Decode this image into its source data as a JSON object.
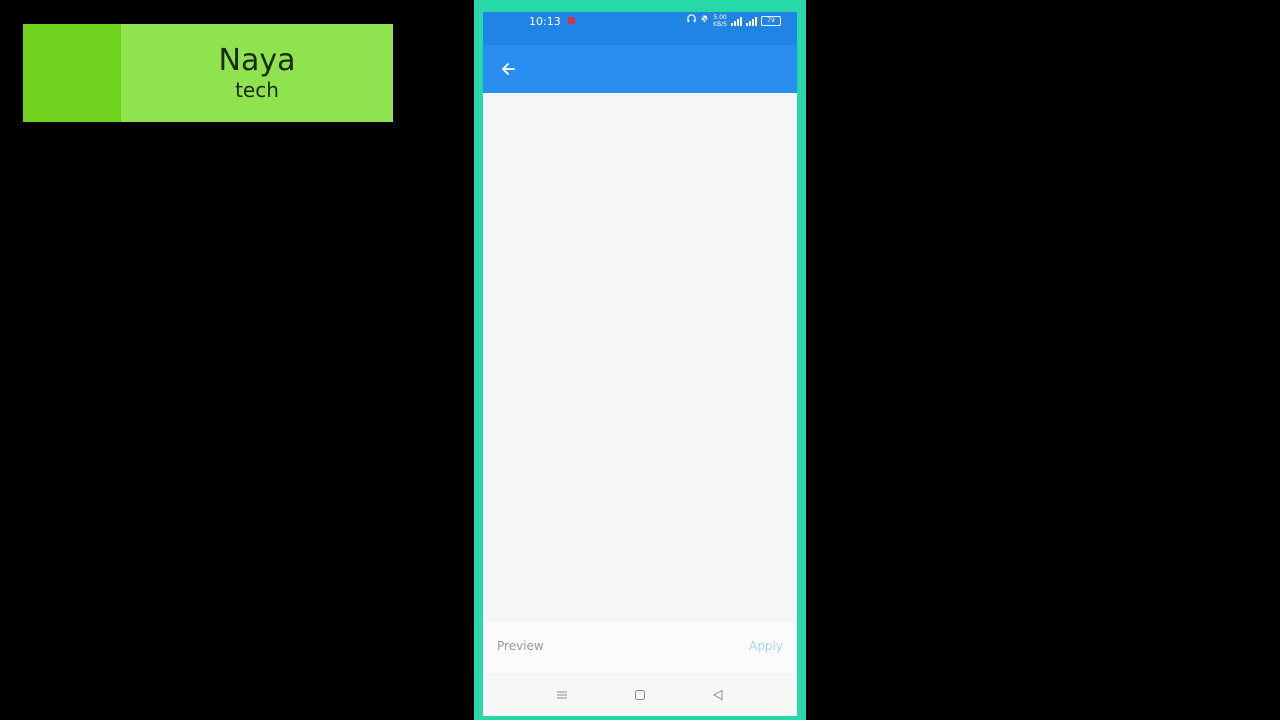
{
  "brand": {
    "name": "Naya",
    "sub": "tech"
  },
  "status_bar": {
    "time": "10:13",
    "net_speed_value": "5.00",
    "net_speed_unit": "KB/S",
    "battery": "79"
  },
  "app_bar": {
    "back_icon": "arrow-left-icon"
  },
  "bottom_actions": {
    "preview_label": "Preview",
    "apply_label": "Apply"
  },
  "nav_bar": {
    "menu_icon": "menu-icon",
    "home_icon": "square-icon",
    "back_icon": "triangle-back-icon"
  },
  "colors": {
    "status_bar": "#1f84e4",
    "app_bar": "#2a8ef0",
    "frame": "#27d9a6",
    "brand_bg": "#8ee34f",
    "brand_accent": "#6fd31e",
    "apply_disabled": "#a9d4f5"
  }
}
